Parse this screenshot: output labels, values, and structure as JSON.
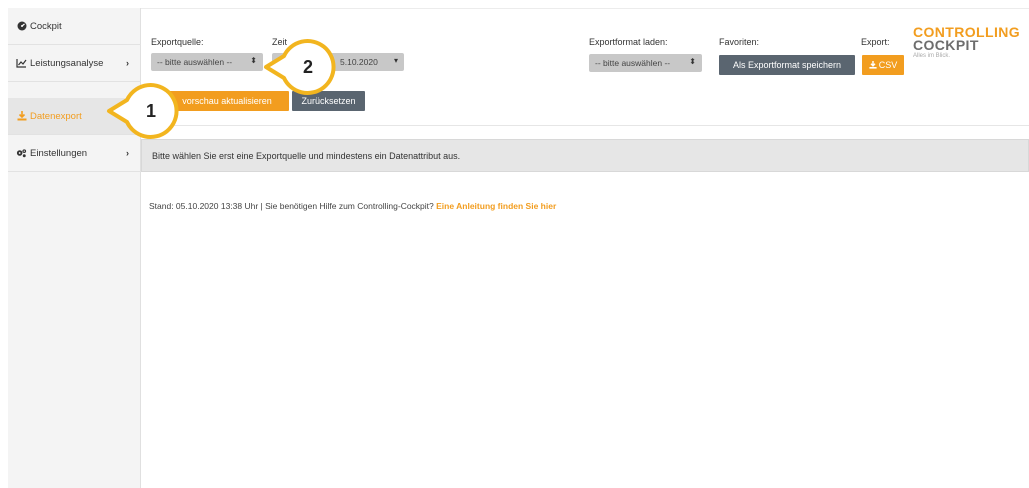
{
  "sidebar": {
    "items": [
      {
        "label": "Cockpit",
        "icon": "dashboard-icon"
      },
      {
        "label": "Leistungsanalyse",
        "icon": "line-chart-icon",
        "chevron": "›"
      },
      {
        "label": "Datenexport",
        "icon": "download-icon"
      },
      {
        "label": "Einstellungen",
        "icon": "gears-icon",
        "chevron": "›"
      }
    ]
  },
  "toolbar": {
    "exportquelle_label": "Exportquelle:",
    "exportquelle_value": "-- bitte auswählen --",
    "zeitraum_label": "Zeit",
    "zeitraum_value": "5.10.2020",
    "vorschau_label": "vorschau aktualisieren",
    "zuruecksetzen_label": "Zurücksetzen",
    "exportformat_label": "Exportformat laden:",
    "exportformat_value": "-- bitte auswählen --",
    "favoriten_label": "Favoriten:",
    "save_format_label": "Als Exportformat speichern",
    "export_label": "Export:",
    "csv_label": "CSV"
  },
  "logo": {
    "line1": "CONTROLLING",
    "line2": "COCKPIT",
    "tagline": "Alles im Blick."
  },
  "info_message": "Bitte wählen Sie erst eine Exportquelle und mindestens ein Datenattribut aus.",
  "footer": {
    "status": "Stand: 05.10.2020 13:38 Uhr | Sie benötigen Hilfe zum Controlling-Cockpit? ",
    "help_link": "Eine Anleitung finden Sie hier"
  },
  "callouts": [
    {
      "number": "1"
    },
    {
      "number": "2"
    }
  ],
  "colors": {
    "accent": "#f29d1f",
    "dark_button": "#5a6570",
    "callout_fill": "#ffffff",
    "callout_stroke": "#f2b51f"
  }
}
